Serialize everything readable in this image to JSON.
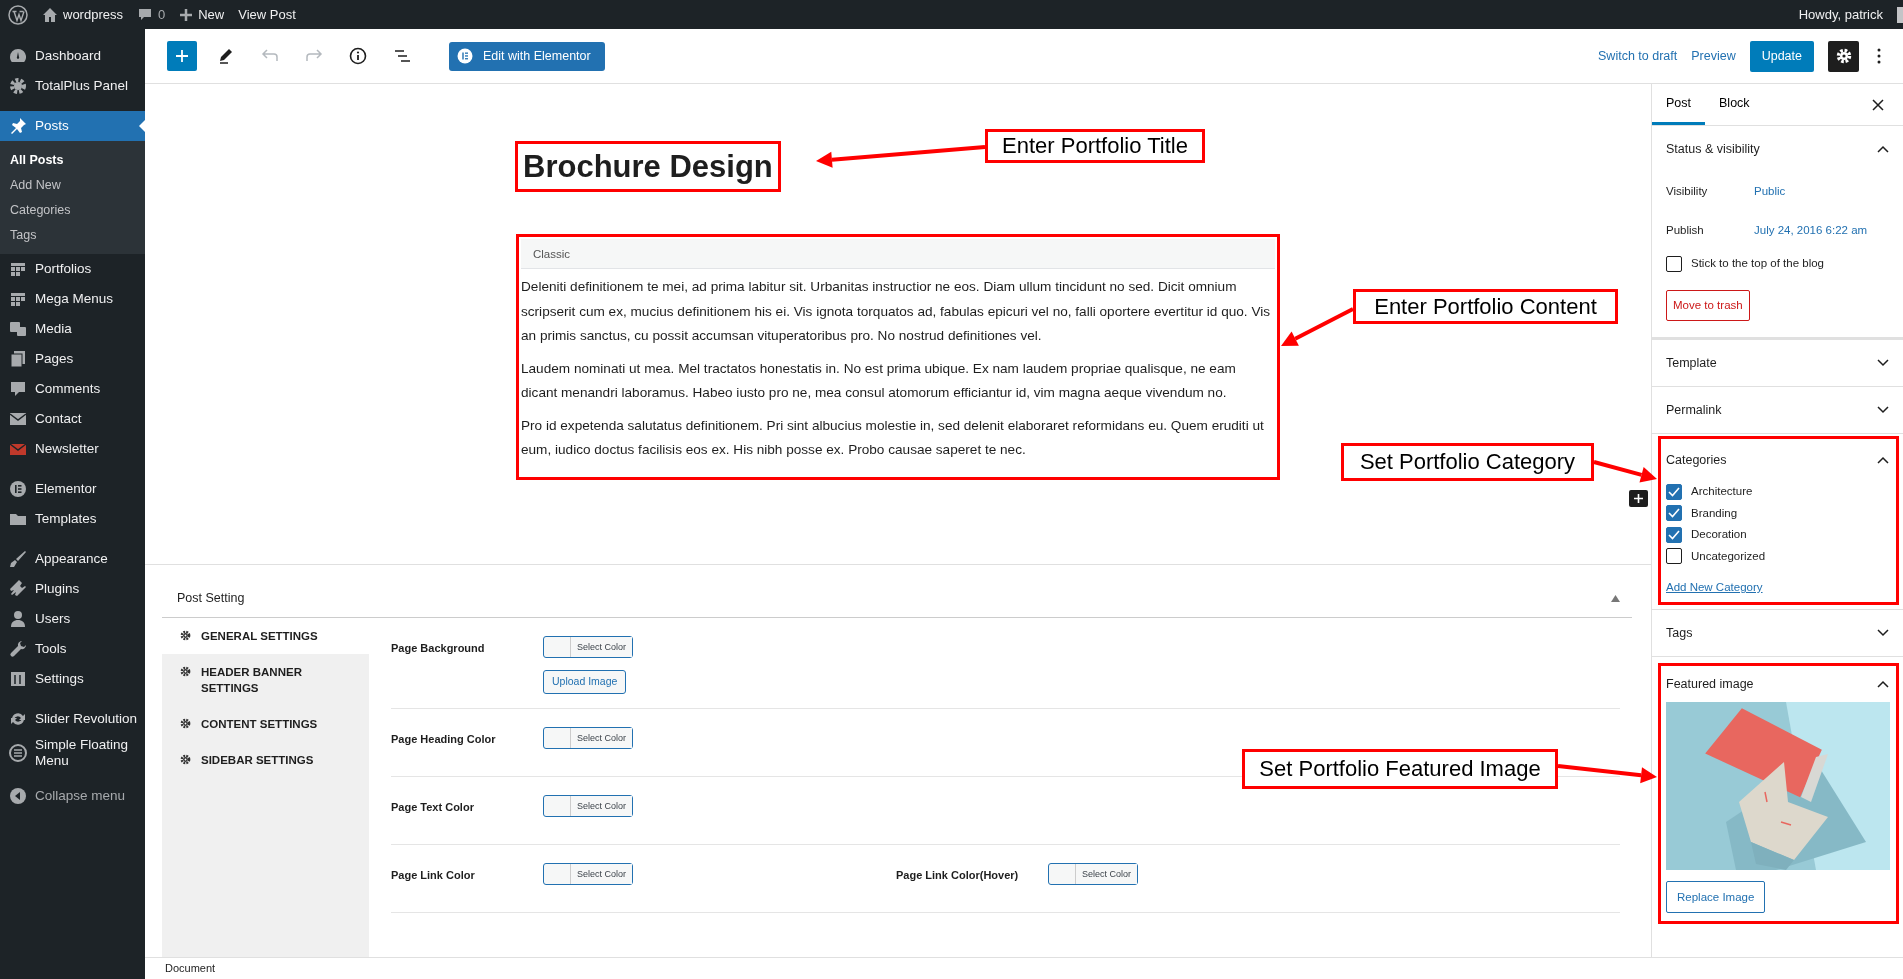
{
  "admin_bar": {
    "site": "wordpress",
    "comments": "0",
    "new": "New",
    "view_post": "View Post",
    "greeting": "Howdy, patrick"
  },
  "admin_menu": [
    {
      "items": [
        {
          "label": "Dashboard",
          "selected": false
        },
        {
          "label": "TotalPlus Panel",
          "selected": false
        }
      ]
    },
    {
      "items": [
        {
          "label": "Posts",
          "selected": true,
          "children": [
            {
              "label": "All Posts",
              "selected": true
            },
            {
              "label": "Add New",
              "selected": false
            },
            {
              "label": "Categories",
              "selected": false
            },
            {
              "label": "Tags",
              "selected": false
            }
          ]
        },
        {
          "label": "Portfolios",
          "selected": false
        },
        {
          "label": "Mega Menus",
          "selected": false
        },
        {
          "label": "Media",
          "selected": false
        },
        {
          "label": "Pages",
          "selected": false
        },
        {
          "label": "Comments",
          "selected": false
        },
        {
          "label": "Contact",
          "selected": false
        },
        {
          "label": "Newsletter",
          "selected": false
        }
      ]
    },
    {
      "items": [
        {
          "label": "Elementor",
          "selected": false
        },
        {
          "label": "Templates",
          "selected": false
        }
      ]
    },
    {
      "items": [
        {
          "label": "Appearance",
          "selected": false
        },
        {
          "label": "Plugins",
          "selected": false
        },
        {
          "label": "Users",
          "selected": false
        },
        {
          "label": "Tools",
          "selected": false
        },
        {
          "label": "Settings",
          "selected": false
        }
      ]
    },
    {
      "items": [
        {
          "label": "Slider Revolution",
          "selected": false
        },
        {
          "label": "Simple Floating Menu",
          "selected": false
        }
      ]
    }
  ],
  "collapse_menu": "Collapse menu",
  "toolbar": {
    "undo": {
      "disabled": true
    },
    "redo": {
      "disabled": true
    },
    "elementor_button": "Edit with Elementor",
    "switch_to_draft": "Switch to draft",
    "preview": "Preview",
    "update": "Update",
    "settings": {
      "pressed": true
    }
  },
  "post": {
    "title": "Brochure Design",
    "block_label": "Classic",
    "paragraphs": [
      "Deleniti definitionem te mei, ad prima labitur sit. Urbanitas instructior ne eos. Diam ullum tincidunt no sed. Dicit omnium scripserit cum ex, mucius definitionem his ei. Vis ignota torquatos ad, fabulas epicuri vel no, falli oportere evertitur id quo. Vis an primis sanctus, cu possit accumsan vituperatoribus pro. No nostrud definitiones vel.",
      "Laudem nominati ut mea. Mel tractatos honestatis in. No est prima ubique. Ex nam laudem propriae qualisque, ne eam dicant menandri laboramus. Habeo iusto pro ne, mea consul atomorum efficiantur id, vim magna aeque vivendum no.",
      "Pro id expetenda salutatus definitionem. Pri sint albucius molestie in, sed delenit elaboraret reformidans eu. Quem eruditi ut eum, iudico doctus facilisis eos ex. His nibh posse ex. Probo causae saperet te nec."
    ]
  },
  "post_settings": {
    "title": "Post Setting",
    "expanded": true,
    "tabs": [
      {
        "label": "GENERAL SETTINGS",
        "selected": true
      },
      {
        "label": "HEADER BANNER SETTINGS",
        "selected": false
      },
      {
        "label": "CONTENT SETTINGS",
        "selected": false
      },
      {
        "label": "SIDEBAR SETTINGS",
        "selected": false
      }
    ],
    "rows": [
      {
        "fields": [
          {
            "label": "Page Background",
            "button": "Select Color",
            "upload": "Upload Image"
          }
        ]
      },
      {
        "fields": [
          {
            "label": "Page Heading Color",
            "button": "Select Color"
          }
        ]
      },
      {
        "fields": [
          {
            "label": "Page Text Color",
            "button": "Select Color"
          }
        ]
      },
      {
        "fields": [
          {
            "label": "Page Link Color",
            "button": "Select Color"
          },
          {
            "label": "Page Link Color(Hover)",
            "button": "Select Color"
          }
        ]
      }
    ]
  },
  "sidebar": {
    "tabs": [
      {
        "label": "Post",
        "selected": true
      },
      {
        "label": "Block",
        "selected": false
      }
    ],
    "panels": [
      {
        "kind": "status",
        "title": "Status & visibility",
        "expanded": true,
        "rows": [
          {
            "label": "Visibility",
            "value": "Public"
          },
          {
            "label": "Publish",
            "value": "July 24, 2016 6:22 am"
          }
        ],
        "sticky": {
          "label": "Stick to the top of the blog",
          "checked": false
        },
        "trash": "Move to trash"
      },
      {
        "kind": "plain",
        "title": "Template",
        "expanded": false
      },
      {
        "kind": "plain",
        "title": "Permalink",
        "expanded": false
      },
      {
        "kind": "categories",
        "title": "Categories",
        "expanded": true,
        "items": [
          {
            "label": "Architecture",
            "checked": true
          },
          {
            "label": "Branding",
            "checked": true
          },
          {
            "label": "Decoration",
            "checked": true
          },
          {
            "label": "Uncategorized",
            "checked": false
          }
        ],
        "add_link": "Add New Category"
      },
      {
        "kind": "plain",
        "title": "Tags",
        "expanded": false
      },
      {
        "kind": "featured",
        "title": "Featured image",
        "expanded": true,
        "replace": "Replace Image"
      }
    ]
  },
  "annotations": [
    "Enter Portfolio Title",
    "Enter Portfolio Content",
    "Set Portfolio Category",
    "Set Portfolio Featured Image"
  ],
  "status_bar": "Document"
}
